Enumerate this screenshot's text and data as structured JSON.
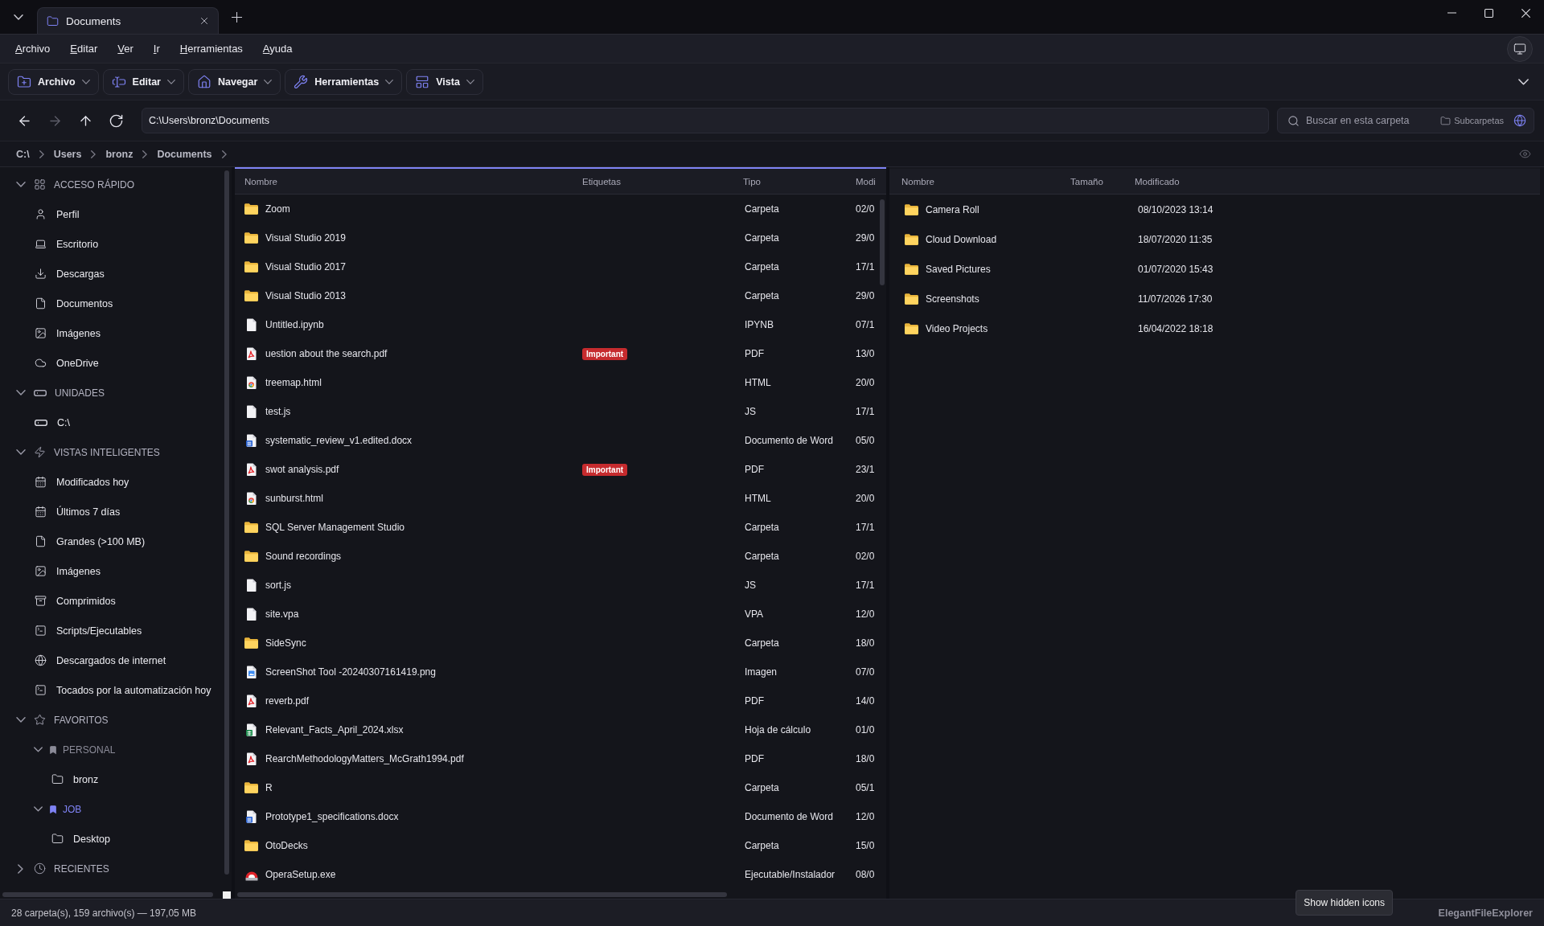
{
  "tabs": [
    {
      "label": "Documents",
      "selected": true
    }
  ],
  "menu": [
    "Archivo",
    "Editar",
    "Ver",
    "Ir",
    "Herramientas",
    "Ayuda"
  ],
  "toolbar": [
    "Archivo",
    "Editar",
    "Navegar",
    "Herramientas",
    "Vista"
  ],
  "nav_buttons": [
    {
      "kind": "back",
      "disabled": false
    },
    {
      "kind": "forward",
      "disabled": true
    },
    {
      "kind": "up",
      "disabled": false
    },
    {
      "kind": "refresh",
      "disabled": false
    }
  ],
  "address": {
    "value": "C:\\Users\\bronz\\Documents"
  },
  "search": {
    "placeholder": "Buscar en esta carpeta",
    "subfolders_label": "Subcarpetas"
  },
  "breadcrumb": [
    "C:\\",
    "Users",
    "bronz",
    "Documents"
  ],
  "sidebar": {
    "sections": [
      {
        "title": "ACCESO RÁPIDO",
        "expanded": true,
        "children": [
          {
            "label": "Perfil"
          },
          {
            "label": "Escritorio"
          },
          {
            "label": "Descargas"
          },
          {
            "label": "Documentos"
          },
          {
            "label": "Imágenes"
          },
          {
            "label": "OneDrive"
          }
        ]
      },
      {
        "title": "UNIDADES",
        "expanded": true,
        "children": [
          {
            "label": "C:\\"
          }
        ]
      },
      {
        "title": "VISTAS INTELIGENTES",
        "expanded": true,
        "children": [
          {
            "label": "Modificados hoy"
          },
          {
            "label": "Últimos 7 días"
          },
          {
            "label": "Grandes (>100 MB)"
          },
          {
            "label": "Imágenes"
          },
          {
            "label": "Comprimidos"
          },
          {
            "label": "Scripts/Ejecutables"
          },
          {
            "label": "Descargados de internet"
          },
          {
            "label": "Tocados por la automatización hoy"
          }
        ]
      },
      {
        "title": "FAVORITOS",
        "expanded": true,
        "children": [
          {
            "label": "PERSONAL",
            "expanded": true,
            "color": "#8b8b98",
            "children": [
              {
                "label": "bronz"
              }
            ]
          },
          {
            "label": "JOB",
            "expanded": true,
            "color": "#7f83f5",
            "children": [
              {
                "label": "Desktop"
              }
            ]
          }
        ]
      },
      {
        "title": "RECIENTES",
        "expanded": false
      }
    ]
  },
  "panes": [
    {
      "active": true,
      "columns": [
        "Nombre",
        "Etiquetas",
        "Tipo",
        "Modi"
      ],
      "rows": [
        {
          "kind": "folder",
          "name": "Zoom",
          "type": "Carpeta",
          "modified": "02/0"
        },
        {
          "kind": "folder",
          "name": "Visual Studio 2019",
          "type": "Carpeta",
          "modified": "29/0"
        },
        {
          "kind": "folder",
          "name": "Visual Studio 2017",
          "type": "Carpeta",
          "modified": "17/1"
        },
        {
          "kind": "folder",
          "name": "Visual Studio 2013",
          "type": "Carpeta",
          "modified": "29/0"
        },
        {
          "kind": "file",
          "name": "Untitled.ipynb",
          "type": "IPYNB",
          "modified": "07/1"
        },
        {
          "kind": "pdf",
          "name": "uestion about the search.pdf",
          "tag": "Important",
          "type": "PDF",
          "modified": "13/0"
        },
        {
          "kind": "html",
          "name": "treemap.html",
          "type": "HTML",
          "modified": "20/0"
        },
        {
          "kind": "file",
          "name": "test.js",
          "type": "JS",
          "modified": "17/1"
        },
        {
          "kind": "word",
          "name": "systematic_review_v1.edited.docx",
          "type": "Documento de Word",
          "modified": "05/0"
        },
        {
          "kind": "pdf",
          "name": "swot analysis.pdf",
          "tag": "Important",
          "type": "PDF",
          "modified": "23/1"
        },
        {
          "kind": "html",
          "name": "sunburst.html",
          "type": "HTML",
          "modified": "20/0"
        },
        {
          "kind": "folder",
          "name": "SQL Server Management Studio",
          "type": "Carpeta",
          "modified": "17/1"
        },
        {
          "kind": "folder",
          "name": "Sound recordings",
          "type": "Carpeta",
          "modified": "02/0"
        },
        {
          "kind": "file",
          "name": "sort.js",
          "type": "JS",
          "modified": "17/1"
        },
        {
          "kind": "file",
          "name": "site.vpa",
          "type": "VPA",
          "modified": "12/0"
        },
        {
          "kind": "folder",
          "name": "SideSync",
          "type": "Carpeta",
          "modified": "18/0"
        },
        {
          "kind": "image",
          "name": "ScreenShot Tool -20240307161419.png",
          "type": "Imagen",
          "modified": "07/0"
        },
        {
          "kind": "pdf",
          "name": "reverb.pdf",
          "type": "PDF",
          "modified": "14/0"
        },
        {
          "kind": "sheet",
          "name": "Relevant_Facts_April_2024.xlsx",
          "type": "Hoja de cálculo",
          "modified": "01/0"
        },
        {
          "kind": "pdf",
          "name": "RearchMethodologyMatters_McGrath1994.pdf",
          "type": "PDF",
          "modified": "18/0"
        },
        {
          "kind": "folder",
          "name": "R",
          "type": "Carpeta",
          "modified": "05/1"
        },
        {
          "kind": "word",
          "name": "Prototype1_specifications.docx",
          "type": "Documento de Word",
          "modified": "12/0"
        },
        {
          "kind": "folder",
          "name": "OtoDecks",
          "type": "Carpeta",
          "modified": "15/0"
        },
        {
          "kind": "exe",
          "name": "OperaSetup.exe",
          "type": "Ejecutable/Instalador",
          "modified": "08/0"
        }
      ]
    },
    {
      "active": false,
      "columns": [
        "Nombre",
        "Tamaño",
        "Modificado"
      ],
      "rows": [
        {
          "kind": "folder",
          "name": "Camera Roll",
          "modified": "08/10/2023 13:14"
        },
        {
          "kind": "folder",
          "name": "Cloud Download",
          "modified": "18/07/2020 11:35"
        },
        {
          "kind": "folder",
          "name": "Saved Pictures",
          "modified": "01/07/2020 15:43"
        },
        {
          "kind": "folder",
          "name": "Screenshots",
          "modified": "11/07/2026 17:30"
        },
        {
          "kind": "folder",
          "name": "Video Projects",
          "modified": "16/04/2022 18:18"
        }
      ]
    }
  ],
  "status_bar": {
    "summary": "28 carpeta(s), 159 archivo(s) — 197,05 MB",
    "app_name": "ElegantFileExplorer"
  },
  "tooltip": "Show hidden icons"
}
